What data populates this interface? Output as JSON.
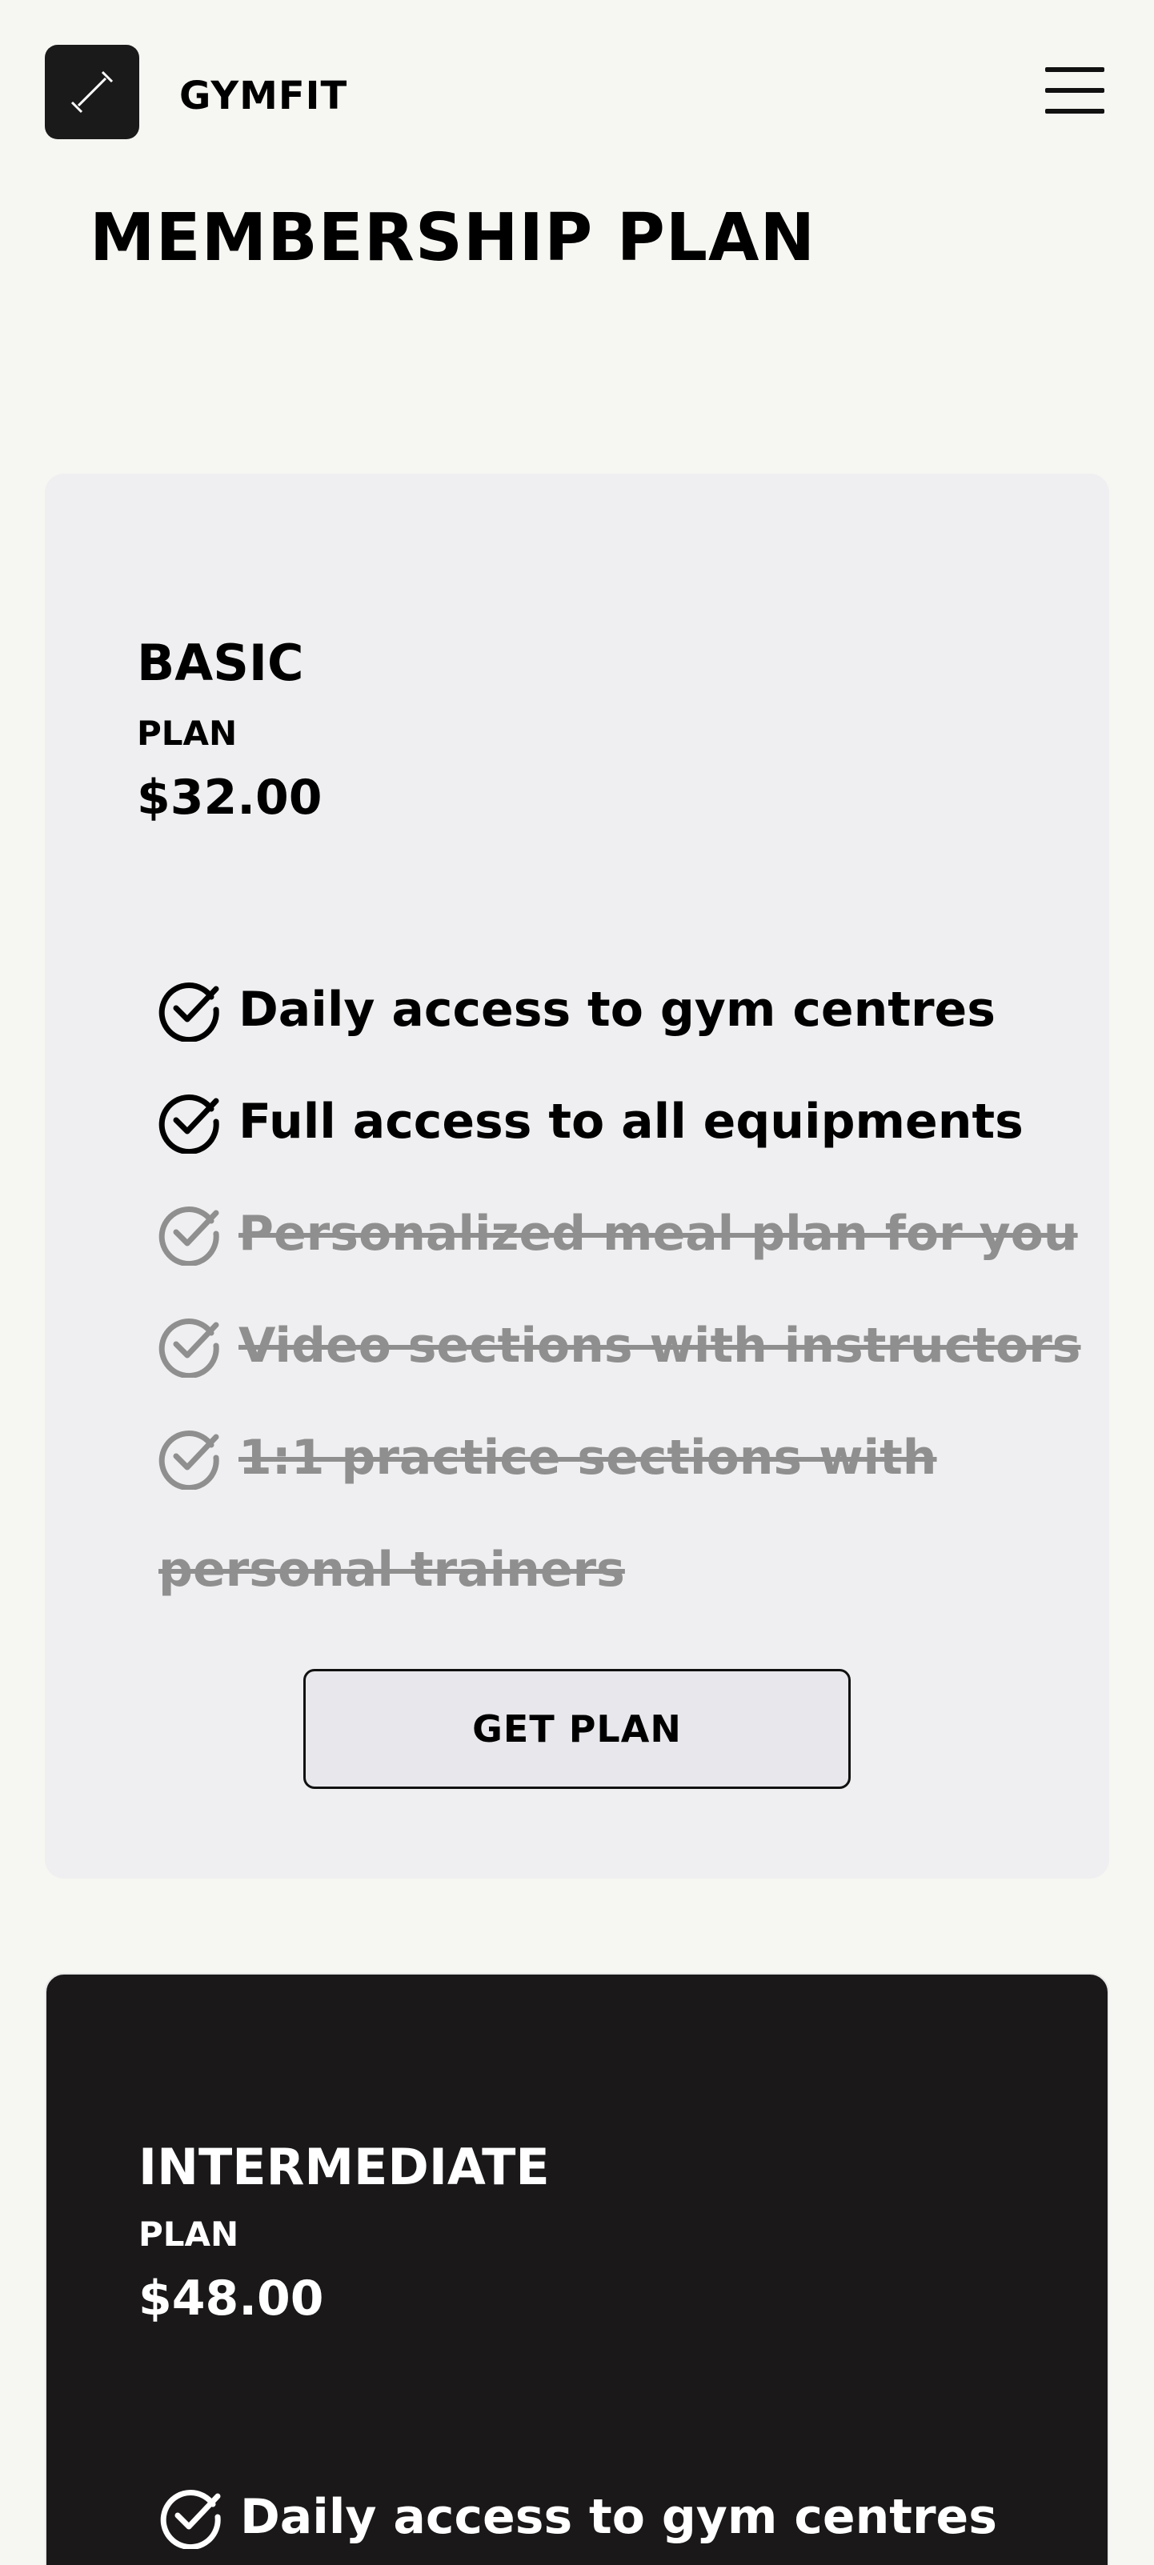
{
  "header": {
    "brand": "GYMFIT",
    "logo_icon": "dumbbell-icon",
    "menu_icon": "hamburger-menu-icon"
  },
  "page_title": "MEMBERSHIP PLAN",
  "plans": [
    {
      "name": "BASIC",
      "sub": "PLAN",
      "price": "$32.00",
      "features": [
        {
          "text": "Daily access to gym centres",
          "included": true
        },
        {
          "text": "Full access to all equipments",
          "included": true
        },
        {
          "text": "Personalized meal plan for you",
          "included": false
        },
        {
          "text": "Video sections with instructors",
          "included": false
        },
        {
          "text": "1:1 practice sections with personal trainers",
          "included": false
        }
      ],
      "button_label": "GET PLAN"
    },
    {
      "name": "INTERMEDIATE",
      "sub": "PLAN",
      "price": "$48.00",
      "features": [
        {
          "text": "Daily access to gym centres",
          "included": true
        }
      ]
    }
  ],
  "colors": {
    "page_bg": "#f6f6f2",
    "basic_card_bg": "#efeff1",
    "intermediate_card_bg": "#1a1819",
    "disabled_text": "#8f8f8f"
  }
}
